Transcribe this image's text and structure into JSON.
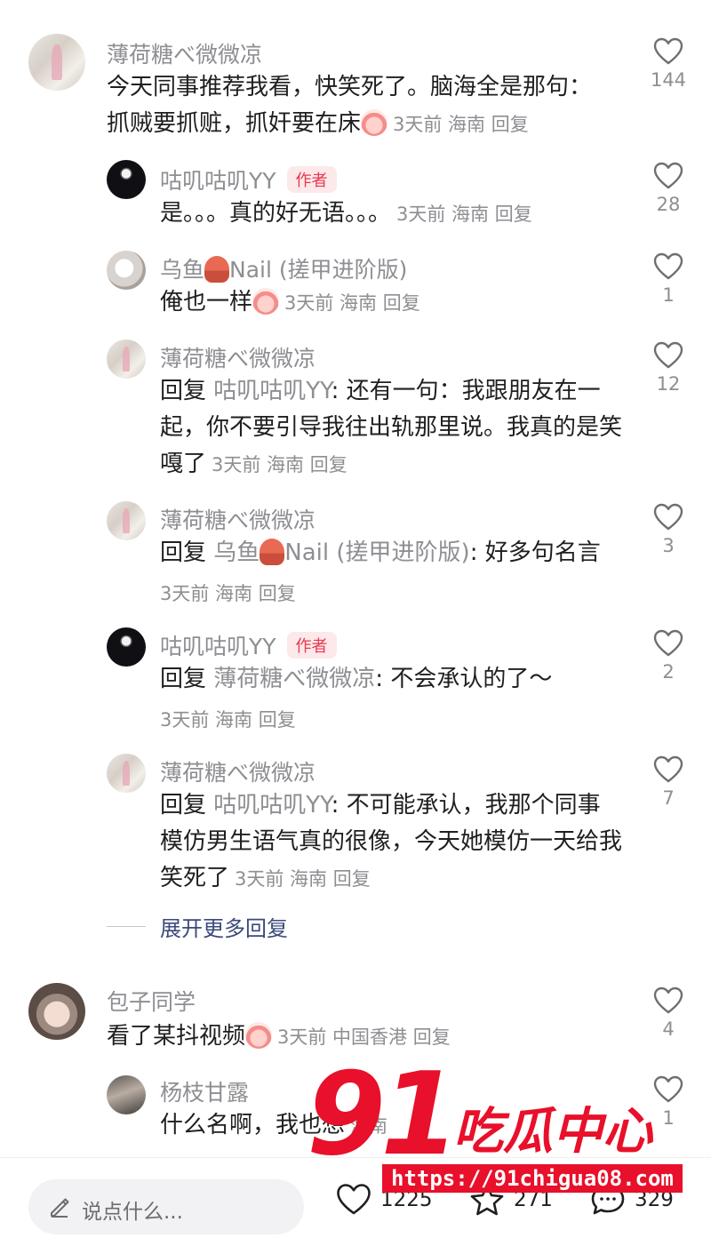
{
  "comments": [
    {
      "name": "薄荷糖べ微微凉",
      "text": "今天同事推荐我看，快笑死了。脑海全是那句：抓贼要抓赃，抓奸要在床",
      "meta": "3天前 海南 回复",
      "likes": "144",
      "avatar": "photo"
    },
    {
      "name": "咕叽咕叽YY",
      "author_tag": "作者",
      "text": "是。。。真的好无语。。。",
      "meta": "3天前 海南 回复",
      "likes": "28",
      "avatar": "dark"
    },
    {
      "name": "乌鱼 Nail (搓甲进阶版)",
      "name_prefix": "乌鱼",
      "name_suffix": "Nail (搓甲进阶版)",
      "text": "俺也一样",
      "meta": "3天前 海南 回复",
      "likes": "1",
      "avatar": "cat"
    },
    {
      "name": "薄荷糖べ微微凉",
      "reply_label": "回复",
      "reply_to": "咕叽咕叽YY",
      "text": ": 还有一句：我跟朋友在一起，你不要引导我往出轨那里说。我真的是笑嘎了",
      "meta": "3天前 海南 回复",
      "likes": "12",
      "avatar": "photo"
    },
    {
      "name": "薄荷糖べ微微凉",
      "reply_label": "回复",
      "reply_to_prefix": "乌鱼",
      "reply_to_suffix": "Nail (搓甲进阶版)",
      "text": ": 好多句名言",
      "meta": "3天前 海南 回复",
      "likes": "3",
      "avatar": "photo"
    },
    {
      "name": "咕叽咕叽YY",
      "author_tag": "作者",
      "reply_label": "回复",
      "reply_to": "薄荷糖べ微微凉",
      "text": ": 不会承认的了～",
      "meta": "3天前 海南 回复",
      "likes": "2",
      "avatar": "dark"
    },
    {
      "name": "薄荷糖べ微微凉",
      "reply_label": "回复",
      "reply_to": "咕叽咕叽YY",
      "text": ": 不可能承认，我那个同事模仿男生语气真的很像，今天她模仿一天给我笑死了",
      "meta": "3天前 海南 回复",
      "likes": "7",
      "avatar": "photo"
    },
    {
      "name": "包子同学",
      "text": "看了某抖视频",
      "meta": "3天前 中国香港 回复",
      "likes": "4",
      "avatar": "girl"
    },
    {
      "name": "杨枝甘露",
      "text": "什么名啊，我也想",
      "meta": "海南",
      "likes": "1",
      "avatar": "men"
    }
  ],
  "expand_label": "展开更多回复",
  "bottom_bar": {
    "input_placeholder": "说点什么...",
    "likes": "1225",
    "stars": "271",
    "comments": "329"
  },
  "watermark": {
    "number": "91",
    "brand": "吃瓜中心",
    "url": "https://91chigua08.com"
  },
  "colors": {
    "author_tag": "#e53950",
    "watermark": "#e8102a",
    "meta": "#8e8e93"
  },
  "icons": [
    "heart-icon",
    "pencil-icon",
    "star-icon",
    "comment-bubble-icon",
    "laughing-crying-emoji",
    "squid-emoji"
  ]
}
